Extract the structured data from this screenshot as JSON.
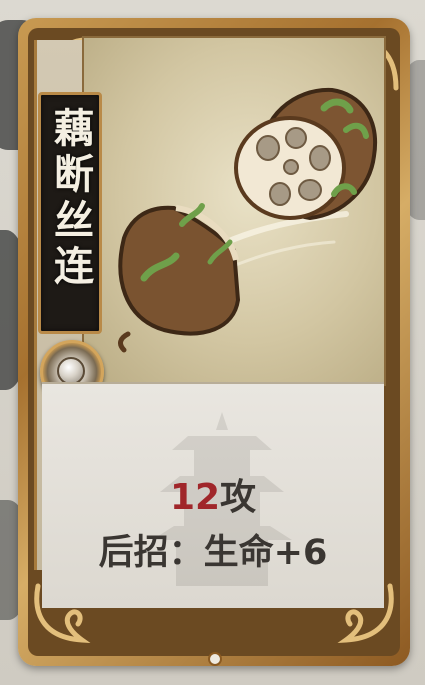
{
  "card": {
    "name": "藕断丝连",
    "attack_value": "12",
    "attack_unit": "攻",
    "follow_up_label": "后招：",
    "follow_up_effect": "生命+6"
  },
  "icons": {
    "art": "lotus-root-icon",
    "gem": "pearl-gem-icon",
    "watermark": "pagoda-icon"
  },
  "colors": {
    "frame_gold": "#c89a52",
    "attack_number": "#a0262a",
    "text_dark": "#3a3632",
    "name_banner": "#1e1a16"
  }
}
